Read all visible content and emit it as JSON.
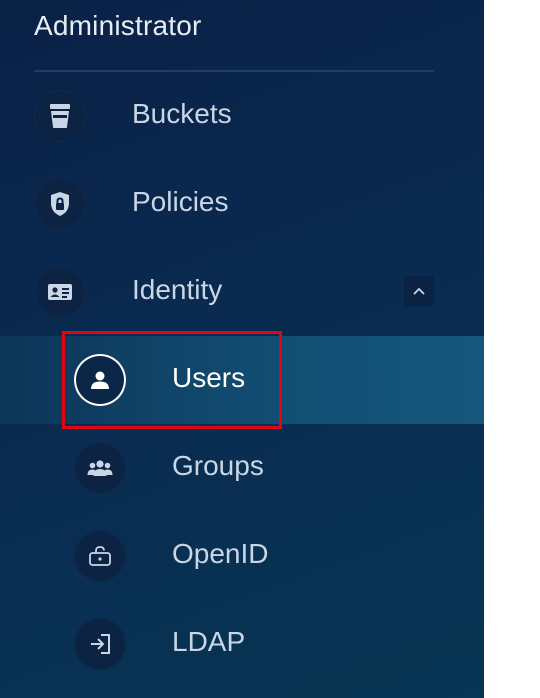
{
  "sidebar": {
    "section_title": "Administrator",
    "items": [
      {
        "label": "Buckets",
        "icon": "bucket-icon"
      },
      {
        "label": "Policies",
        "icon": "shield-lock-icon"
      },
      {
        "label": "Identity",
        "icon": "id-card-icon",
        "expanded": true
      },
      {
        "label": "Users",
        "icon": "user-icon",
        "active": true
      },
      {
        "label": "Groups",
        "icon": "group-icon"
      },
      {
        "label": "OpenID",
        "icon": "unlock-icon"
      },
      {
        "label": "LDAP",
        "icon": "login-icon"
      }
    ],
    "colors": {
      "background": "#0a2146",
      "active_row": "#124f74",
      "highlight_box": "#e00712",
      "text": "#c9d6e6"
    }
  }
}
